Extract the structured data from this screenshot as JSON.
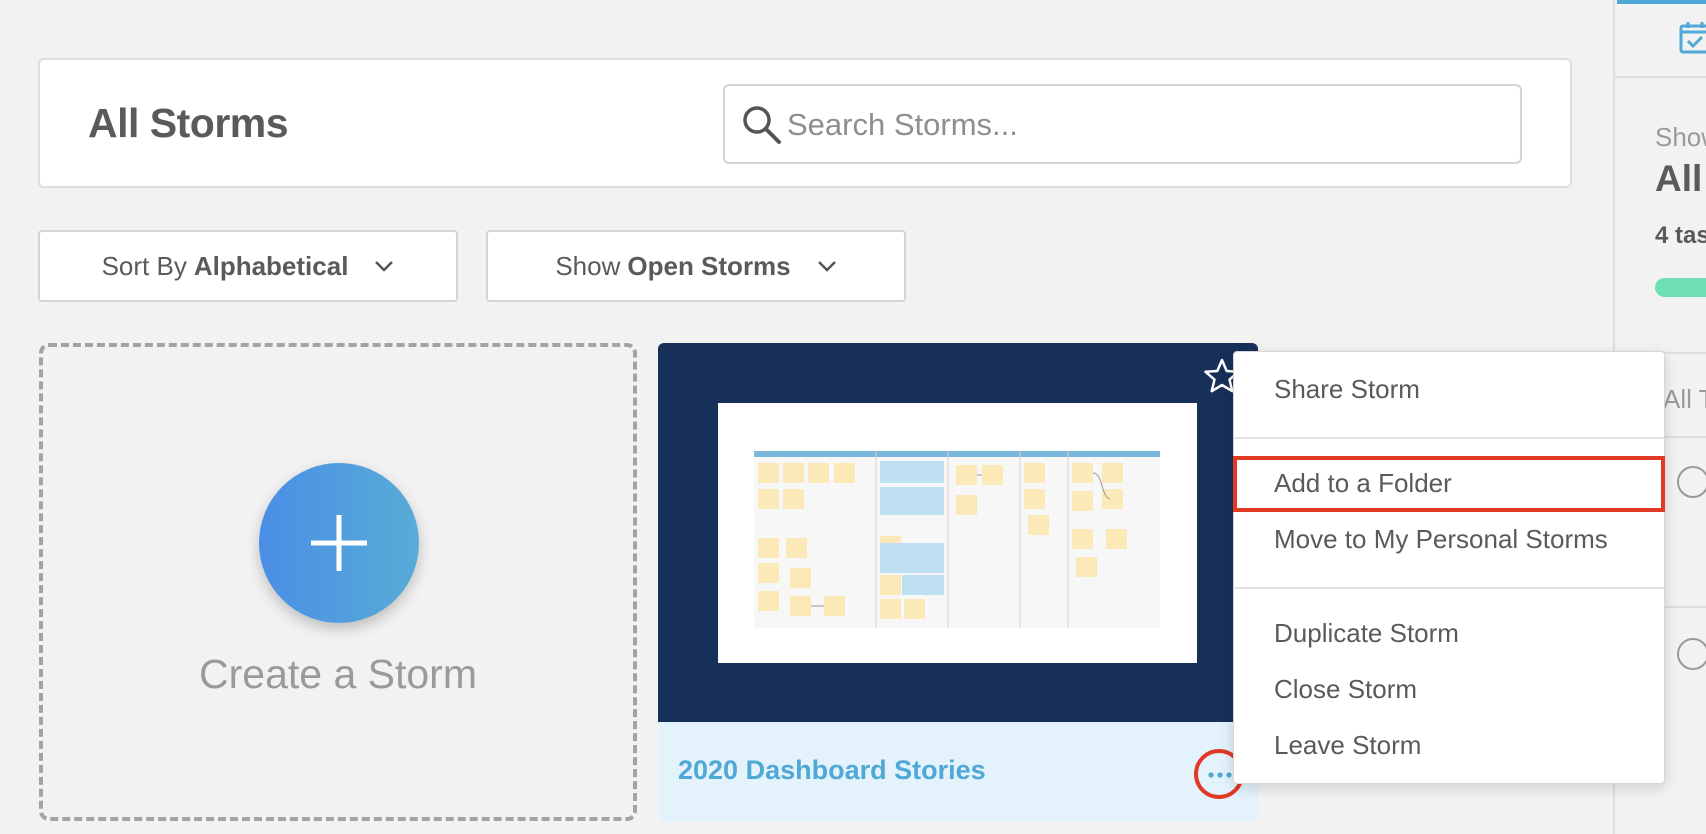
{
  "header": {
    "title": "All Storms",
    "search_placeholder": "Search Storms..."
  },
  "filters": {
    "sort_prefix": "Sort By",
    "sort_value": "Alphabetical",
    "show_prefix": "Show",
    "show_value": "Open Storms"
  },
  "create_card": {
    "label": "Create a Storm"
  },
  "storm_card": {
    "name": "2020 Dashboard Stories",
    "starred": false
  },
  "context_menu": {
    "items": [
      "Share Storm",
      "Add to a Folder",
      "Move to My Personal Storms",
      "Duplicate Storm",
      "Close Storm",
      "Leave Storm"
    ],
    "highlighted": "Add to a Folder"
  },
  "right_panel": {
    "show_label": "Show",
    "filter_value": "All",
    "task_count": "4 tas",
    "tab_label": "All T"
  },
  "colors": {
    "accent_blue": "#4fa8d6",
    "card_dark": "#17305a",
    "highlight_red": "#e03a25",
    "progress_green": "#6ee0b4"
  },
  "icons": [
    "search-icon",
    "chevron-down-icon",
    "plus-icon",
    "star-icon",
    "more-dots-icon",
    "calendar-check-icon"
  ]
}
